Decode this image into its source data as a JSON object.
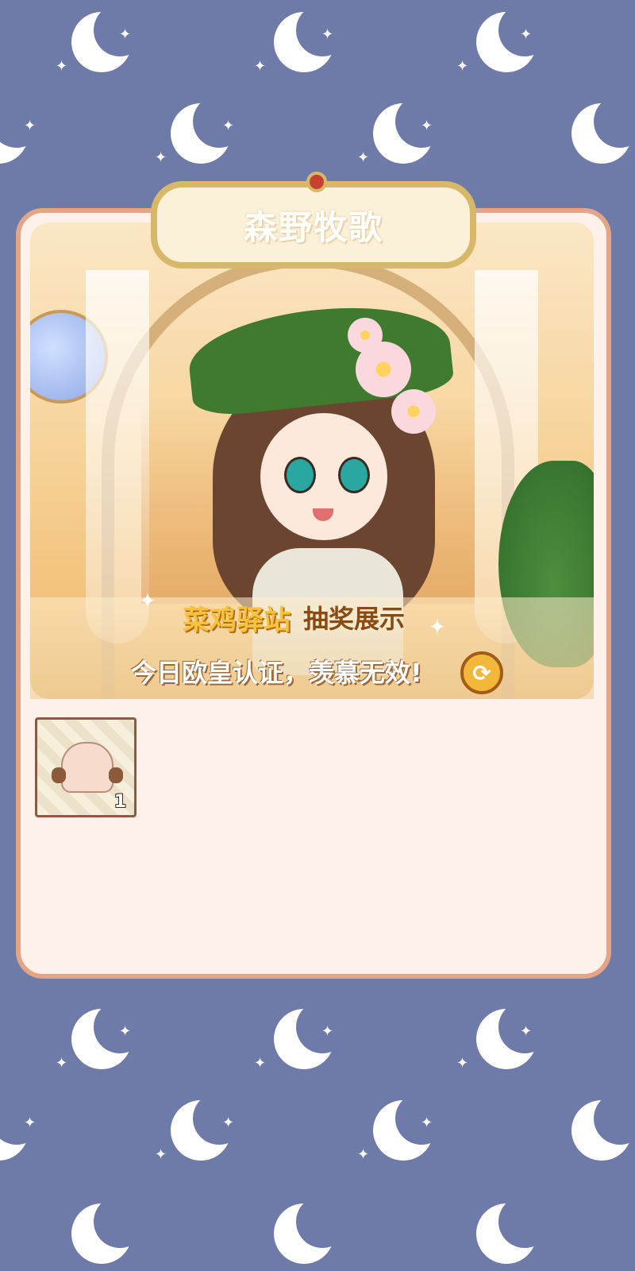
{
  "popup": {
    "title": "森野牧歌",
    "caption_brand": "菜鸡驿站",
    "caption_show": "抽奖展示",
    "caption_subtitle": "今日欧皇认证，羡慕无效!"
  },
  "items": [
    {
      "icon": "outfit-top-icon",
      "count": "1"
    }
  ],
  "colors": {
    "background": "#6e7aa8",
    "card_border": "#e3a586",
    "card_fill": "#fdf1ea",
    "plaque_border": "#d7b768",
    "brand_yellow": "#f7c33a"
  },
  "icons": {
    "refresh": "refresh-icon",
    "moon": "moon-icon",
    "star": "star-icon"
  }
}
